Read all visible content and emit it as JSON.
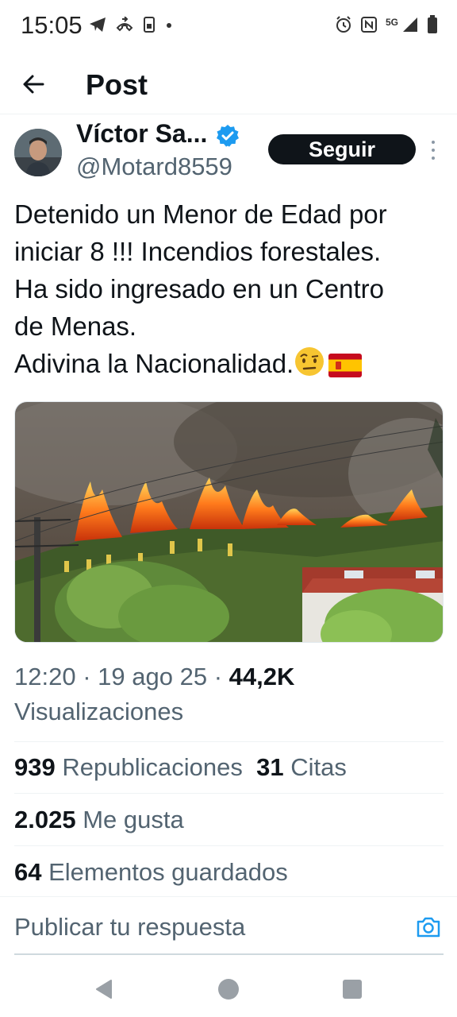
{
  "status_bar": {
    "time": "15:05",
    "network": "5G",
    "left_icons": [
      "telegram-icon",
      "call-forward-icon",
      "sim-icon",
      "dot-icon"
    ],
    "right_icons": [
      "alarm-icon",
      "nfc-icon",
      "signal-icon",
      "battery-icon"
    ]
  },
  "header": {
    "title": "Post"
  },
  "author": {
    "display_name": "Víctor Sa...",
    "handle": "@Motard8559",
    "verified": true,
    "follow_label": "Seguir"
  },
  "tweet": {
    "lines": [
      "Detenido un Menor de Edad por",
      "iniciar 8 !!! Incendios forestales.",
      "Ha sido ingresado en un Centro",
      "de Menas.",
      "Adivina la Nacionalidad."
    ],
    "emojis": [
      "face-with-raised-eyebrow-emoji",
      "spain-flag-emoji"
    ]
  },
  "meta": {
    "time": "12:20",
    "date": "19 ago 25",
    "views_count": "44,2K",
    "views_label": "Visualizaciones"
  },
  "stats": {
    "reposts_count": "939",
    "reposts_label": "Republicaciones",
    "quotes_count": "31",
    "quotes_label": "Citas",
    "likes_count": "2.025",
    "likes_label": "Me gusta",
    "bookmarks_count": "64",
    "bookmarks_label": "Elementos guardados"
  },
  "reply": {
    "placeholder": "Publicar tu respuesta"
  },
  "colors": {
    "accent": "#1d9bf0",
    "text_primary": "#0f1419",
    "text_secondary": "#536471",
    "divider": "#eff3f4"
  }
}
